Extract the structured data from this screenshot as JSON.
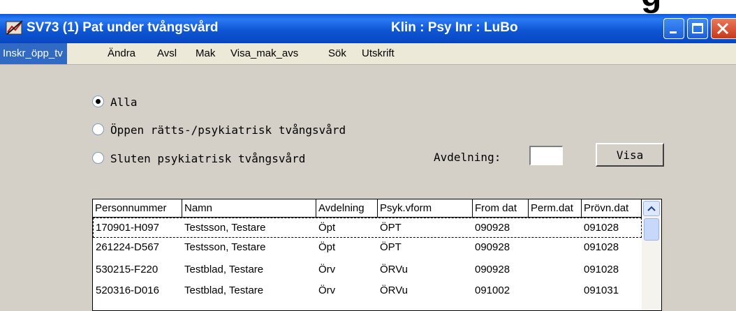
{
  "page_fragment": "g",
  "window": {
    "title": "SV73 (1) Pat under tvångsvård",
    "context": "Klin : Psy  Inr : LuBo",
    "controls": [
      "minimize-icon",
      "maximize-icon",
      "close-icon"
    ]
  },
  "menu": [
    "Inskr_öpp_tv",
    "Ändra",
    "Avsl",
    "Mak",
    "Visa_mak_avs",
    "Sök",
    "Utskrift"
  ],
  "filter": {
    "options": [
      "Alla",
      "Öppen rätts-/psykiatrisk tvångsvård",
      "Sluten psykiatrisk tvångsvård"
    ],
    "selected": "Alla",
    "avdelning_label": "Avdelning:",
    "avdelning_value": "",
    "visa_label": "Visa"
  },
  "table": {
    "columns": [
      "Personnummer",
      "Namn",
      "Avdelning",
      "Psyk.vform",
      "From dat",
      "Perm.dat",
      "Prövn.dat"
    ],
    "rows": [
      [
        "170901-H097",
        "Testsson, Testare",
        "Öpt",
        "ÖPT",
        "090928",
        "",
        "091028"
      ],
      [
        "261224-D567",
        "Testsson, Testare",
        "Öpt",
        "ÖPT",
        "090928",
        "",
        "091028"
      ],
      [
        "530215-F220",
        "Testblad, Testare",
        "Örv",
        "ÖRVu",
        "090928",
        "",
        "091028"
      ],
      [
        "520316-D016",
        "Testblad, Testare",
        "Örv",
        "ÖRVu",
        "091002",
        "",
        "091031"
      ]
    ]
  },
  "colors": {
    "titlebar": "#0a5ae0",
    "menu_highlight": "#316ac5",
    "window_bg": "#d4d0c8",
    "close_button": "#d8532f"
  }
}
